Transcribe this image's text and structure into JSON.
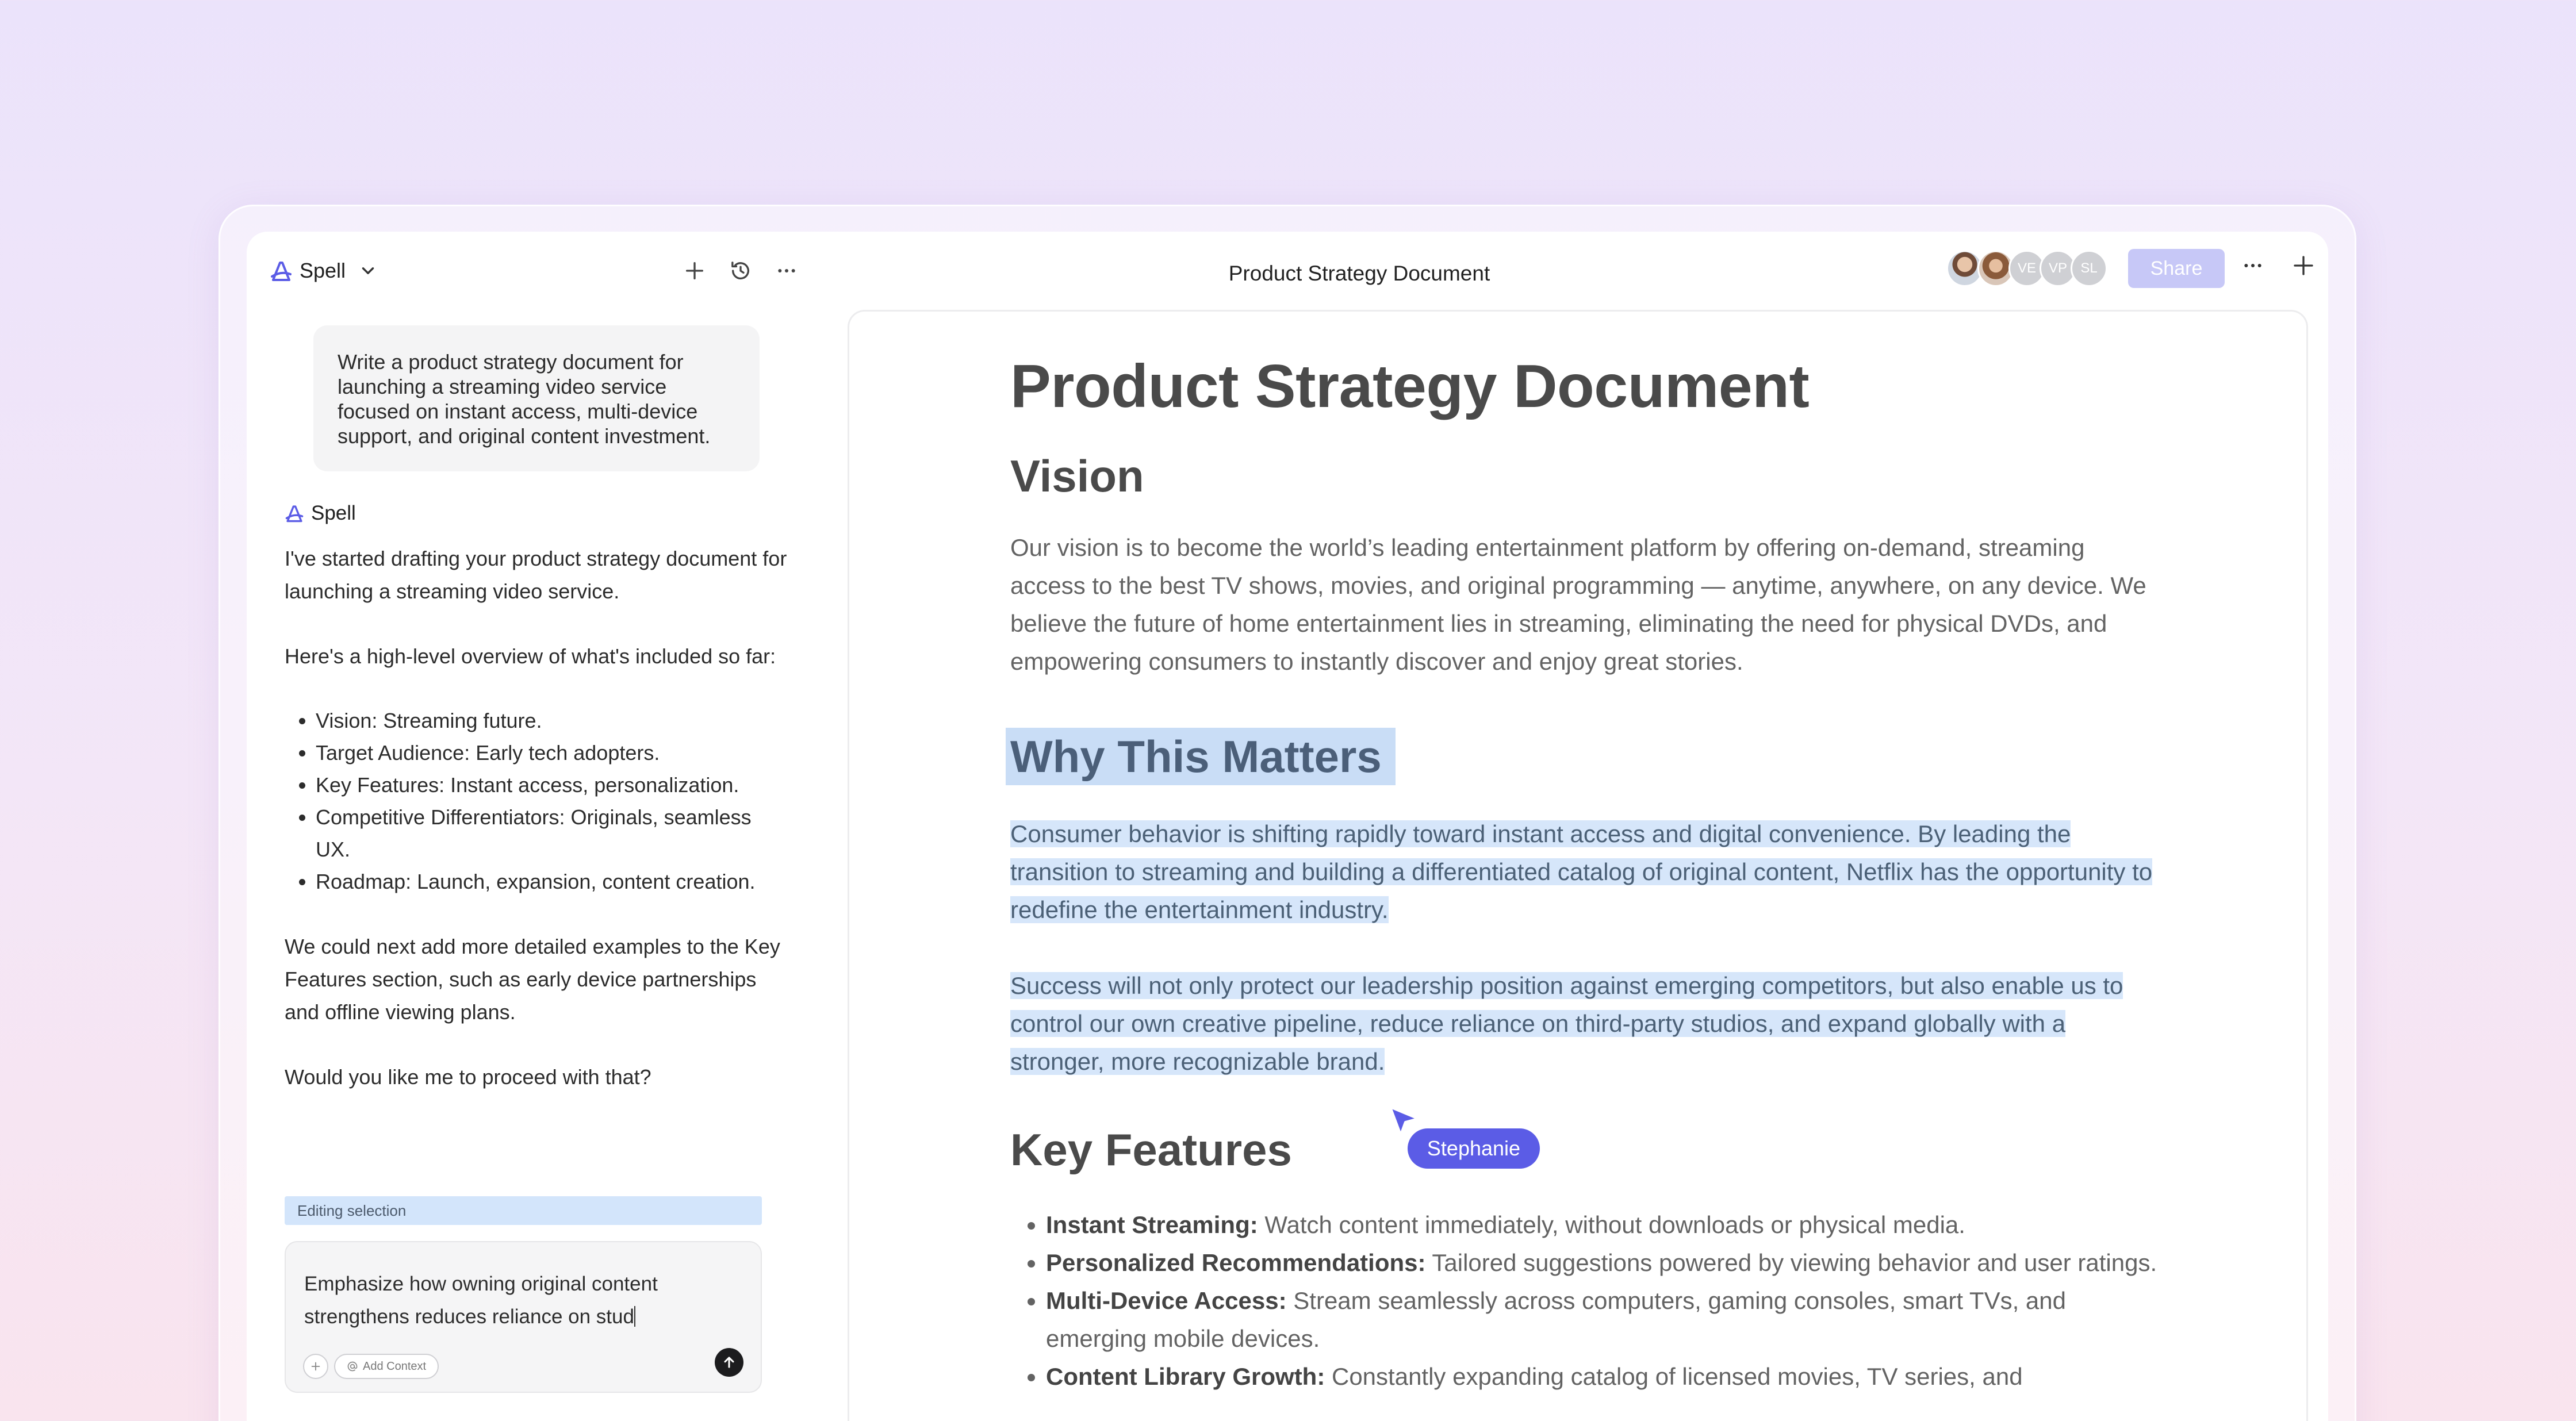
{
  "sidebar": {
    "brand": "Spell",
    "prompt": "Write a product strategy document for launching a streaming video service focused on instant access, multi-device support, and original content investment.",
    "assistant_name": "Spell",
    "reply": {
      "intro": "I've started drafting your product strategy document for launching a streaming video service.",
      "overview": "Here's a high-level overview of what's included so far:",
      "items": [
        "Vision: Streaming future.",
        "Target Audience: Early tech adopters.",
        "Key Features: Instant access, personalization.",
        "Competitive Differentiators: Originals, seamless UX.",
        "Roadmap: Launch, expansion, content creation."
      ],
      "next": "We could next add more detailed examples to the Key Features section, such as early device partnerships and offline viewing plans.",
      "question": "Would you like me to proceed with that?"
    },
    "editing_label": "Editing selection",
    "composer": {
      "text": "Emphasize how owning original content strengthens reduces reliance on stud",
      "add_context": "Add Context"
    }
  },
  "topbar": {
    "doc_title": "Product Strategy Document",
    "avatars": [
      "",
      "",
      "VE",
      "VP",
      "SL"
    ],
    "share_label": "Share"
  },
  "document": {
    "title": "Product Strategy Document",
    "vision_heading": "Vision",
    "vision_text": "Our vision is to become the world’s leading entertainment platform by offering on-demand, streaming access to the best TV shows, movies, and original programming — anytime, anywhere, on any device. We believe the future of home entertainment lies in streaming, eliminating the need for physical DVDs, and empowering consumers to instantly discover and enjoy great stories.",
    "why_heading": "Why This Matters",
    "why_p1": "Consumer behavior is shifting rapidly toward instant access and digital convenience. By leading the transition to streaming and building a differentiated catalog of original content, Netflix has the opportunity to redefine the entertainment industry.",
    "why_p2": "Success will not only protect our leadership position against emerging competitors, but also enable us to control our own creative pipeline, reduce reliance on third-party studios, and expand globally with a stronger, more recognizable brand.",
    "features_heading": "Key Features",
    "features": [
      {
        "label": "Instant Streaming:",
        "text": " Watch content immediately, without downloads or physical media."
      },
      {
        "label": "Personalized Recommendations:",
        "text": " Tailored suggestions powered by viewing behavior and user ratings."
      },
      {
        "label": "Multi-Device Access:",
        "text": " Stream seamlessly across computers, gaming consoles, smart TVs, and emerging mobile devices."
      },
      {
        "label": "Content Library Growth:",
        "text": " Constantly expanding catalog of licensed movies, TV series, and"
      }
    ]
  },
  "collaborator_cursor": {
    "name": "Stephanie",
    "color": "#5b5ce6"
  },
  "colors": {
    "selection": "#d6e6fa",
    "accent": "#5b5ce6",
    "share_disabled": "#c7c8f7"
  }
}
